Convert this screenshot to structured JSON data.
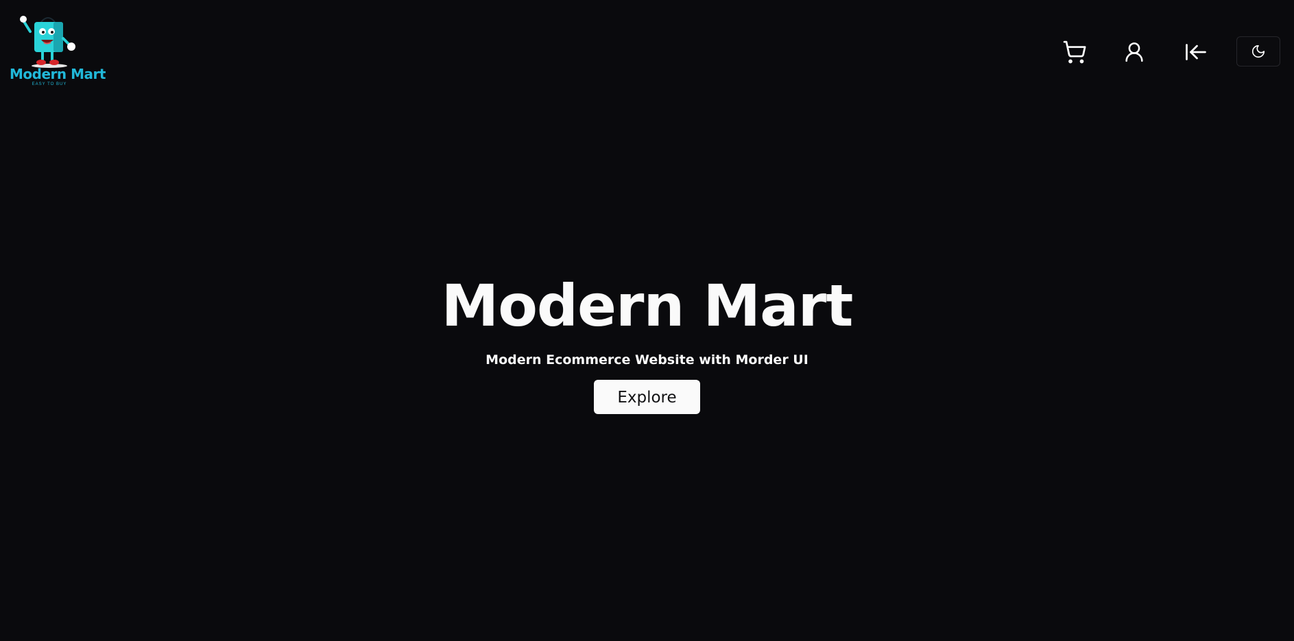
{
  "header": {
    "logo": {
      "text": "Modern Mart",
      "tagline": "EASY TO BUY",
      "brand_color": "#21b8d9"
    },
    "icons": {
      "cart": "cart-icon",
      "user": "user-icon",
      "logout": "logout-icon",
      "theme": "moon-icon"
    }
  },
  "hero": {
    "title": "Modern Mart",
    "subtitle": "Modern Ecommerce Website with Morder UI",
    "button_label": "Explore"
  },
  "colors": {
    "background": "#0a0a0d",
    "text": "#fafafa",
    "button_bg": "#fafafa",
    "button_text": "#111113"
  }
}
